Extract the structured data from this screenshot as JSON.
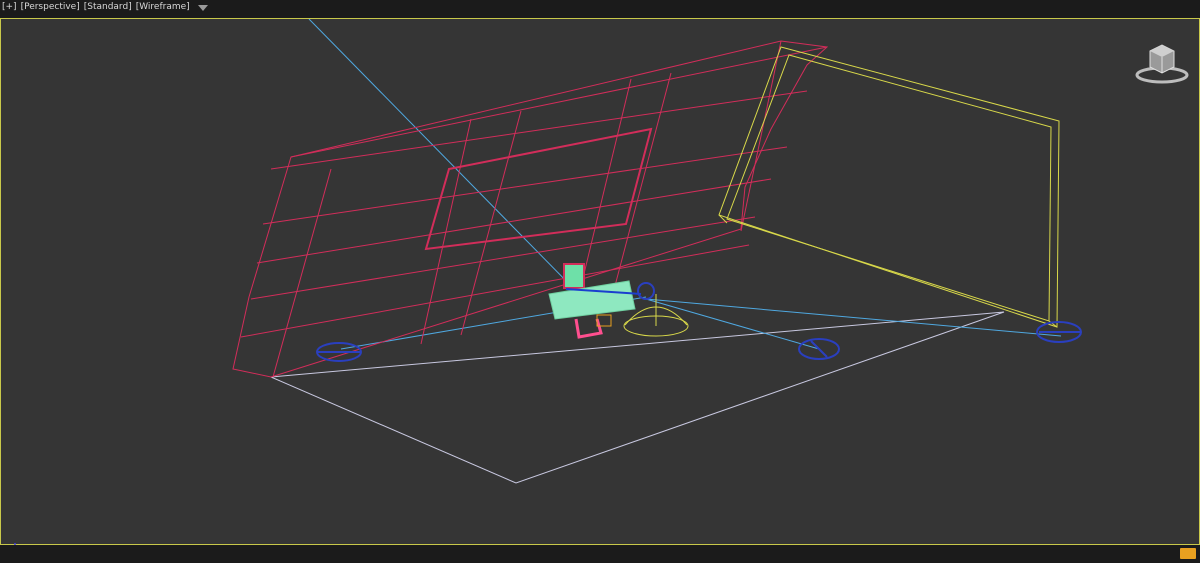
{
  "viewport": {
    "labels": [
      "[+]",
      "[Perspective]",
      "[Standard]",
      "[Wireframe]"
    ]
  },
  "icons": {
    "filter": "funnel-icon",
    "viewcube": "viewcube-icon",
    "axis": "axis-tripod-icon"
  },
  "colors": {
    "viewport_bg": "#353535",
    "active_border": "#c8c84a",
    "shelf_wire": "#d22d5a",
    "panel_wire": "#d8d84a",
    "light_wire": "#2a3fbf",
    "target_line": "#4fa8e0"
  }
}
